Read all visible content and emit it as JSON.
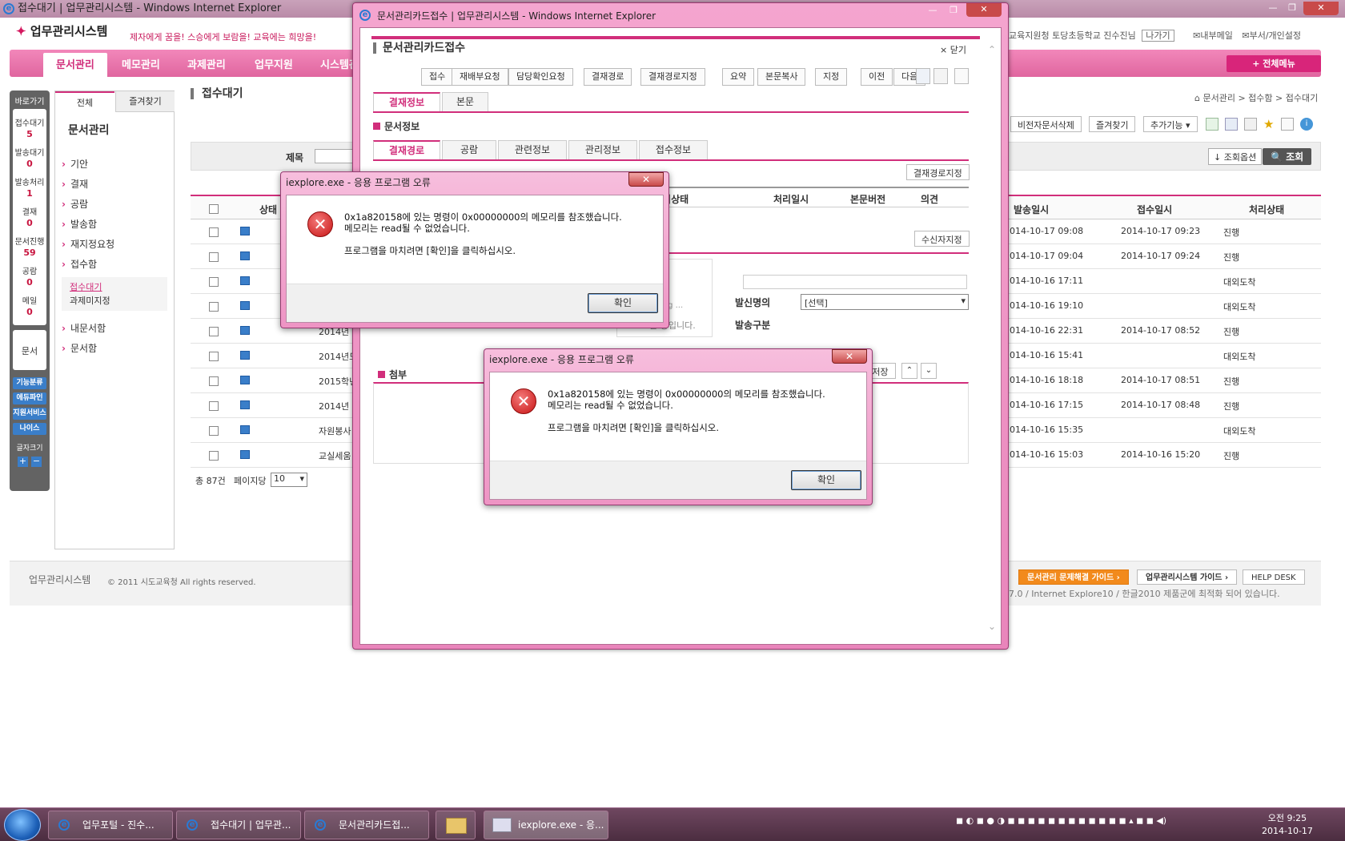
{
  "main_window": {
    "title": "접수대기 | 업무관리시스템 - Windows Internet Explorer"
  },
  "header": {
    "logo": "업무관리시스템",
    "slogan": "제자에게 꿈을! 스승에게 보람을! 교육에는 희망을!",
    "user": "교육지원청 토당초등학교 진수진님",
    "logout": "나가기",
    "links": [
      "내부메일",
      "부서/개인설정"
    ],
    "all_menu": "+ 전체메뉴"
  },
  "nav": {
    "items": [
      "문서관리",
      "메모관리",
      "과제관리",
      "업무지원",
      "시스템관"
    ]
  },
  "quick": {
    "title": "바로가기",
    "items": [
      {
        "label": "접수대기",
        "count": "5"
      },
      {
        "label": "발송대기",
        "count": "0"
      },
      {
        "label": "발송처리",
        "count": "1"
      },
      {
        "label": "결재",
        "count": "0"
      },
      {
        "label": "문서진행",
        "count": "59"
      },
      {
        "label": "공람",
        "count": "0"
      },
      {
        "label": "메일",
        "count": "0"
      }
    ],
    "doc": "문서",
    "buttons": [
      "기능분류",
      "에듀파인",
      "지원서비스",
      "나이스"
    ],
    "fontsize": "글자크기"
  },
  "leftmenu": {
    "tabs": [
      "전체",
      "즐겨찾기"
    ],
    "title": "문서관리",
    "items": [
      "기안",
      "결재",
      "공람",
      "발송함",
      "재지정요청",
      "접수함"
    ],
    "sub": [
      "접수대기",
      "과제미지정"
    ],
    "items2": [
      "내문서함",
      "문서함"
    ]
  },
  "page": {
    "title": "접수대기",
    "breadcrumb": "문서관리 > 접수함 > 접수대기",
    "tools": [
      "비전자문서삭제",
      "즐겨찾기",
      "추가기능"
    ],
    "search_label": "제목",
    "search_options": "조회옵션",
    "search_button": "조회",
    "columns": [
      "상태",
      "발송일시",
      "접수일시",
      "처리상태"
    ],
    "rows": [
      {
        "title": "",
        "sent": "2014-10-17 09:08",
        "recv": "2014-10-17 09:23",
        "status": "진행"
      },
      {
        "title": "",
        "sent": "2014-10-17 09:04",
        "recv": "2014-10-17 09:24",
        "status": "진행"
      },
      {
        "title": "",
        "sent": "2014-10-16 17:11",
        "recv": "",
        "status": "대외도착"
      },
      {
        "title": "",
        "sent": "2014-10-16 19:10",
        "recv": "",
        "status": "대외도착"
      },
      {
        "title": "2014년",
        "sent": "2014-10-16 22:31",
        "recv": "2014-10-17 08:52",
        "status": "진행"
      },
      {
        "title": "2014년도",
        "sent": "2014-10-16 15:41",
        "recv": "",
        "status": "대외도착"
      },
      {
        "title": "2015학년",
        "sent": "2014-10-16 18:18",
        "recv": "2014-10-17 08:51",
        "status": "진행"
      },
      {
        "title": "2014년",
        "sent": "2014-10-16 17:15",
        "recv": "2014-10-17 08:48",
        "status": "진행"
      },
      {
        "title": "자원봉사",
        "sent": "2014-10-16 15:35",
        "recv": "",
        "status": "대외도착"
      },
      {
        "title": "교실세움",
        "sent": "2014-10-16 15:03",
        "recv": "2014-10-16 15:20",
        "status": "진행"
      }
    ],
    "total": "총 87건",
    "per_page_label": "페이지당",
    "per_page": "10"
  },
  "footer": {
    "logo": "업무관리시스템",
    "copyright": "© 2011  시도교육청  All rights reserved.",
    "guide1": "문서관리 문제해결 가이드",
    "guide2": "업무관리시스템 가이드",
    "helpdesk": "HELP DESK",
    "note": "7.0 / Internet Explore10 / 한글2010 제품군에 최적화 되어 있습니다."
  },
  "popup": {
    "window_title": "문서관리카드접수 | 업무관리시스템 - Windows Internet Explorer",
    "title": "문서관리카드접수",
    "close": "닫기",
    "toolbar": [
      "접수",
      "재배부요청",
      "담당확인요청",
      "결재경로",
      "결재경로지정",
      "요약",
      "본문복사",
      "지정",
      "이전",
      "다음"
    ],
    "tabs_main": [
      "결재정보",
      "본문"
    ],
    "section_doc": "문서정보",
    "tabs_sub": [
      "결재경로",
      "공람",
      "관련정보",
      "관리정보",
      "접수정보"
    ],
    "path_button": "결재경로지정",
    "columns": [
      "처리상태",
      "처리일시",
      "본문버전",
      "의견"
    ],
    "recipient_button": "수신자지정",
    "loading": "Loading ...",
    "loading_msg": "오는 중입니다.",
    "sender_label": "발신명의",
    "sender_value": "[선택]",
    "send_type_label": "발송구분",
    "attach": "첨부",
    "pc_save": "PC저장"
  },
  "dialogs": [
    {
      "title": "iexplore.exe - 응용 프로그램 오류",
      "line1": "0x1a820158에 있는 명령이 0x00000000의 메모리를 참조했습니다.",
      "line2": "메모리는 read될 수 없었습니다.",
      "line3": "프로그램을 마치려면 [확인]을 클릭하십시오.",
      "ok": "확인"
    },
    {
      "title": "iexplore.exe - 응용 프로그램 오류",
      "line1": "0x1a820158에 있는 명령이 0x00000000의 메모리를 참조했습니다.",
      "line2": "메모리는 read될 수 없었습니다.",
      "line3": "프로그램을 마치려면 [확인]을 클릭하십시오.",
      "ok": "확인"
    }
  ],
  "taskbar": {
    "items": [
      "업무포털 - 진수...",
      "접수대기 | 업무관...",
      "문서관리카드접...",
      "",
      "iexplore.exe - 응..."
    ],
    "time": "오전 9:25",
    "date": "2014-10-17"
  },
  "colors": {
    "accent": "#d12e7b",
    "nav": "#e879af",
    "error": "#c71414"
  }
}
